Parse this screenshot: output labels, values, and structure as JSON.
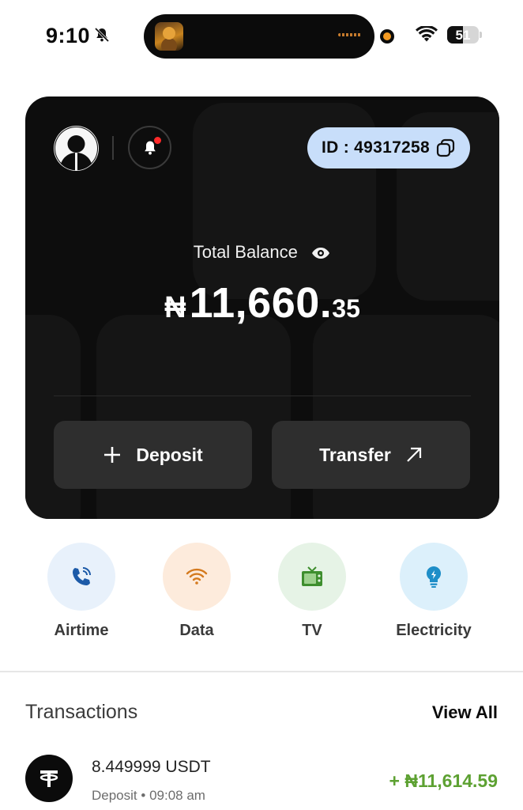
{
  "status_bar": {
    "time": "9:10",
    "battery": "51",
    "battery_level_percent": 51
  },
  "card": {
    "account_id": "ID : 49317258",
    "balance_label": "Total Balance",
    "balance_currency": "₦",
    "balance_main": "11,660.",
    "balance_decimals": "35",
    "deposit_label": "Deposit",
    "transfer_label": "Transfer"
  },
  "services": [
    {
      "label": "Airtime",
      "icon": "phone-icon",
      "bg": "#e8f1fb",
      "fg": "#1c5aa8"
    },
    {
      "label": "Data",
      "icon": "wifi-icon",
      "bg": "#fdebdc",
      "fg": "#d47a1e"
    },
    {
      "label": "TV",
      "icon": "tv-icon",
      "bg": "#e6f3e6",
      "fg": "#3e8e2e"
    },
    {
      "label": "Electricity",
      "icon": "bulb-icon",
      "bg": "#dcf0fb",
      "fg": "#1e8ec8"
    }
  ],
  "transactions": {
    "title": "Transactions",
    "view_all": "View All",
    "items": [
      {
        "amount": "8.449999 USDT",
        "type": "Deposit",
        "separator": "•",
        "time": "09:08 am",
        "value": "+ ₦11,614.59",
        "value_color": "#5da132"
      }
    ]
  },
  "colors": {
    "card_bg": "#0d0d0d",
    "id_pill": "#c8defa",
    "button_bg": "#2e2e2e",
    "positive": "#5da132"
  }
}
